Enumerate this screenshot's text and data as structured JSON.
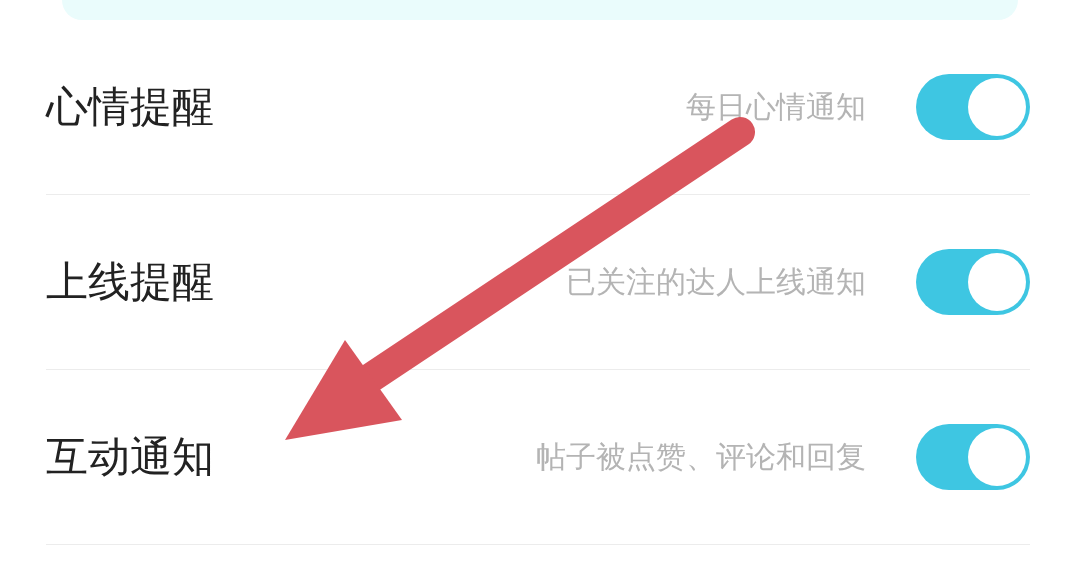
{
  "settings": [
    {
      "label": "心情提醒",
      "description": "每日心情通知",
      "on": true
    },
    {
      "label": "上线提醒",
      "description": "已关注的达人上线通知",
      "on": true
    },
    {
      "label": "互动通知",
      "description": "帖子被点赞、评论和回复",
      "on": true
    }
  ]
}
